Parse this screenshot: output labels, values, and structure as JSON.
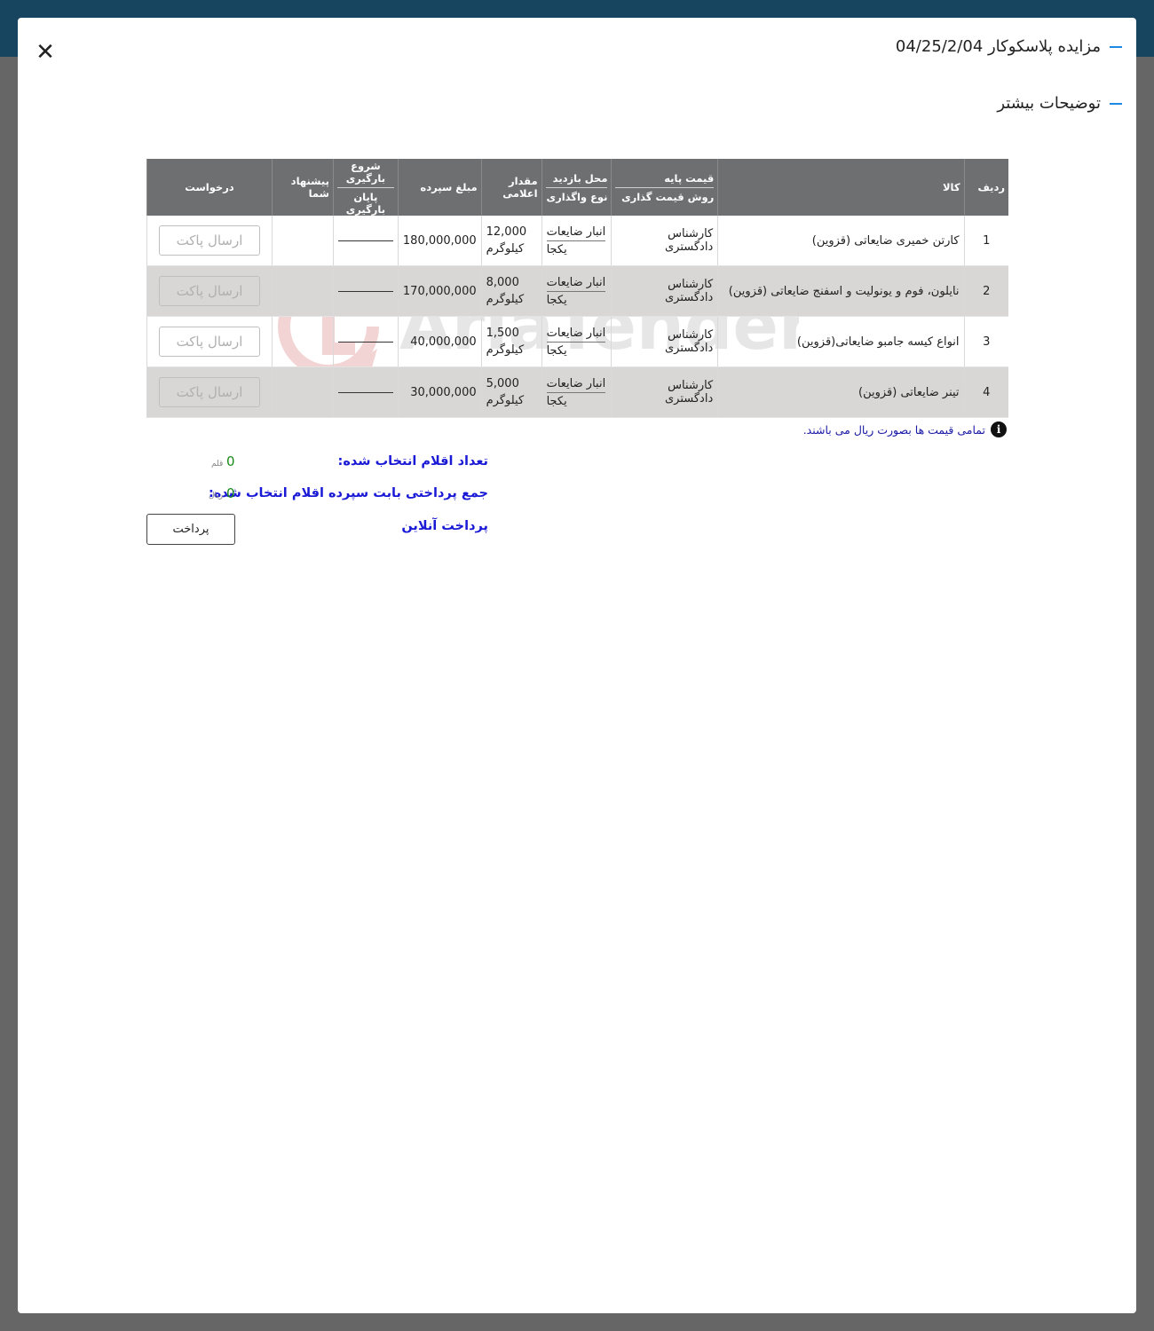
{
  "modal": {
    "title": "مزایده پلاسکوکار 04/25/2/04",
    "section_title": "توضیحات بیشتر"
  },
  "table": {
    "headers": {
      "row": "ردیف",
      "item": "کالا",
      "base_price": "قیمت پایه",
      "pricing_method": "روش قیمت گذاری",
      "visit_location": "محل بازدید",
      "transfer_type": "نوع واگذاری",
      "quantity": "مقدار اعلامی",
      "deposit": "مبلغ سپرده",
      "load_start": "شروع بارگیری",
      "load_end": "پایان بارگیری",
      "your_offer": "پیشنهاد شما",
      "request": "درخواست"
    },
    "rows": [
      {
        "num": "1",
        "item": "کارتن خمیری ضایعاتی (قزوین)",
        "pricing": "کارشناس دادگستری",
        "location": "انبار ضایعات",
        "transfer": "یکجا",
        "qty": "12,000",
        "unit": "کیلوگرم",
        "deposit": "180,000,000",
        "button": "ارسال پاکت"
      },
      {
        "num": "2",
        "item": "نایلون، فوم و یونولیت و اسفنج ضایعاتی (قزوین)",
        "pricing": "کارشناس دادگستری",
        "location": "انبار ضایعات",
        "transfer": "یکجا",
        "qty": "8,000",
        "unit": "کیلوگرم",
        "deposit": "170,000,000",
        "button": "ارسال پاکت"
      },
      {
        "num": "3",
        "item": "انواع کیسه جامبو ضایعاتی(قزوین)",
        "pricing": "کارشناس دادگستری",
        "location": "انبار ضایعات",
        "transfer": "یکجا",
        "qty": "1,500",
        "unit": "کیلوگرم",
        "deposit": "40,000,000",
        "button": "ارسال پاکت"
      },
      {
        "num": "4",
        "item": "تینر ضایعاتی (قزوین)",
        "pricing": "کارشناس دادگستری",
        "location": "انبار ضایعات",
        "transfer": "یکجا",
        "qty": "5,000",
        "unit": "کیلوگرم",
        "deposit": "30,000,000",
        "button": "ارسال پاکت"
      }
    ]
  },
  "note": {
    "text": "تمامی قیمت ها بصورت ریال می باشند.",
    "icon": "info-icon"
  },
  "summary": {
    "count_label": "تعداد اقلام انتخاب شده:",
    "count_value": "0",
    "count_unit": "قلم",
    "total_label": "جمع پرداختی بابت سپرده اقلام انتخاب شده:",
    "total_value": "0",
    "total_unit": "ریال",
    "online_pay_label": "پرداخت آنلاین",
    "pay_button": "پرداخت"
  },
  "watermark": {
    "text": "AriaTender.neT"
  },
  "colors": {
    "header_bg": "#6e6f70",
    "alt_row_bg": "#d9d6d6",
    "accent": "#1e88e5",
    "summary_label": "#1a1ad6",
    "summary_value": "#1b8a1b",
    "topbar": "#17445f",
    "overlay": "#666666"
  }
}
